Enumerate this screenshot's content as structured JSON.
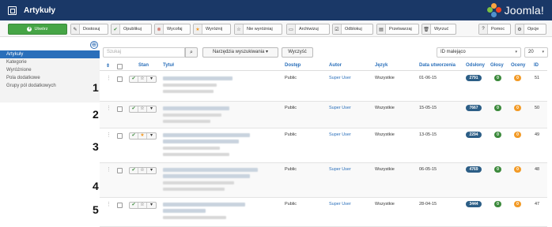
{
  "header": {
    "title": "Artykuły",
    "brand": "Joomla!"
  },
  "toolbar": {
    "buttons": [
      {
        "label": "Utwórz",
        "icon": "plus-icon"
      },
      {
        "label": "Dostosuj",
        "icon": "edit-icon"
      },
      {
        "label": "Opublikuj",
        "icon": "check-icon"
      },
      {
        "label": "Wycofaj",
        "icon": "unpublish-icon"
      },
      {
        "label": "Wyróżnij",
        "icon": "star-icon"
      },
      {
        "label": "Nie wyróżniaj",
        "icon": "star-empty-icon"
      },
      {
        "label": "Archiwizuj",
        "icon": "archive-icon"
      },
      {
        "label": "Odblokuj",
        "icon": "checkin-icon"
      },
      {
        "label": "Przetwarzaj",
        "icon": "batch-icon"
      },
      {
        "label": "Wyrzuć",
        "icon": "trash-icon"
      },
      {
        "label": "Pomoc",
        "icon": "help-icon"
      },
      {
        "label": "Opcje",
        "icon": "gear-icon"
      }
    ]
  },
  "sidebar": {
    "items": [
      {
        "label": "Artykuły",
        "active": true
      },
      {
        "label": "Kategorie"
      },
      {
        "label": "Wyróżnione"
      },
      {
        "label": "Pola dodatkowe"
      },
      {
        "label": "Grupy pól dodatkowych"
      }
    ]
  },
  "filters": {
    "search_placeholder": "Szukaj",
    "tools_label": "Narzędzia wyszukiwania ▾",
    "clear_label": "Wyczyść",
    "sort_label": "ID malejąco",
    "limit_label": "20"
  },
  "table": {
    "headers": {
      "status": "Stan",
      "title": "Tytuł",
      "access": "Dostęp",
      "author": "Autor",
      "language": "Język",
      "created": "Data utworzenia",
      "hits": "Odsłony",
      "votes": "Głosy",
      "ratings": "Oceny",
      "id": "ID"
    },
    "rows": [
      {
        "num": "1",
        "access": "Public",
        "author": "Super User",
        "language": "Wszystkie",
        "date": "01-06-15",
        "hits": "2791",
        "votes": "0",
        "ratings": "0",
        "id": "51",
        "featured": false
      },
      {
        "num": "2",
        "access": "Public",
        "author": "Super User",
        "language": "Wszystkie",
        "date": "15-05-15",
        "hits": "7667",
        "votes": "0",
        "ratings": "0",
        "id": "50",
        "featured": false
      },
      {
        "num": "3",
        "access": "Public",
        "author": "Super User",
        "language": "Wszystkie",
        "date": "13-05-15",
        "hits": "2294",
        "votes": "0",
        "ratings": "0",
        "id": "49",
        "featured": true
      },
      {
        "num": "4",
        "access": "Public",
        "author": "Super User",
        "language": "Wszystkie",
        "date": "06-05-15",
        "hits": "4769",
        "votes": "0",
        "ratings": "0",
        "id": "48",
        "featured": false
      },
      {
        "num": "5",
        "access": "Public",
        "author": "Super User",
        "language": "Wszystkie",
        "date": "28-04-15",
        "hits": "3444",
        "votes": "0",
        "ratings": "0",
        "id": "47",
        "featured": false
      }
    ]
  },
  "colors": {
    "header_bg": "#1a3867",
    "accent": "#2a6fba",
    "new_button": "#46a546",
    "hits_badge": "#2c5e86",
    "votes_badge": "#3c8a3c",
    "ratings_badge": "#f29a26"
  }
}
